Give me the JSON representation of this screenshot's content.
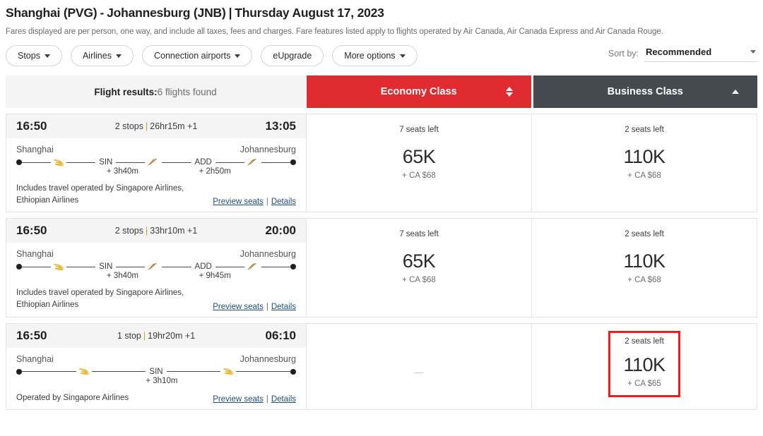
{
  "header": {
    "origin": "Shanghai (PVG)",
    "dash": "-",
    "destination": "Johannesburg (JNB)",
    "separator": "|",
    "date": "Thursday August 17, 2023",
    "fare_note": "Fares displayed are per person, one way, and include all taxes, fees and charges. Fare features listed apply to flights operated by Air Canada, Air Canada Express and Air Canada Rouge."
  },
  "filters": {
    "stops": "Stops",
    "airlines": "Airlines",
    "connection_airports": "Connection airports",
    "eupgrade": "eUpgrade",
    "more_options": "More options",
    "sort_label": "Sort by:",
    "sort_value": "Recommended"
  },
  "columns": {
    "results_label": "Flight results:",
    "results_count": "6 flights found",
    "economy": "Economy Class",
    "business": "Business Class"
  },
  "colors": {
    "economy_header": "#e02b31",
    "business_header": "#444a50",
    "highlight": "#ee1d1d",
    "link": "#1f4e79"
  },
  "flights": [
    {
      "depart_time": "16:50",
      "arrive_time": "13:05",
      "stops": "2 stops",
      "duration": "26hr15m +1",
      "next_day": "+1",
      "origin_city": "Shanghai",
      "destination_city": "Johannesburg",
      "stop_codes": [
        "SIN",
        "ADD"
      ],
      "layovers": [
        "+ 3h40m",
        "+ 2h50m"
      ],
      "operated_by": "Includes travel operated by Singapore Airlines, Ethiopian Airlines",
      "preview_seats": "Preview seats",
      "details": "Details",
      "economy": {
        "seats": "7 seats left",
        "miles": "65K",
        "tax": "+ CA $68",
        "available": true,
        "highlighted": false
      },
      "business": {
        "seats": "2 seats left",
        "miles": "110K",
        "tax": "+ CA $68",
        "available": true,
        "highlighted": false
      }
    },
    {
      "depart_time": "16:50",
      "arrive_time": "20:00",
      "stops": "2 stops",
      "duration": "33hr10m +1",
      "next_day": "+1",
      "origin_city": "Shanghai",
      "destination_city": "Johannesburg",
      "stop_codes": [
        "SIN",
        "ADD"
      ],
      "layovers": [
        "+ 3h40m",
        "+ 9h45m"
      ],
      "operated_by": "Includes travel operated by Singapore Airlines, Ethiopian Airlines",
      "preview_seats": "Preview seats",
      "details": "Details",
      "economy": {
        "seats": "7 seats left",
        "miles": "65K",
        "tax": "+ CA $68",
        "available": true,
        "highlighted": false
      },
      "business": {
        "seats": "2 seats left",
        "miles": "110K",
        "tax": "+ CA $68",
        "available": true,
        "highlighted": false
      }
    },
    {
      "depart_time": "16:50",
      "arrive_time": "06:10",
      "stops": "1 stop",
      "duration": "19hr20m +1",
      "next_day": "+1",
      "origin_city": "Shanghai",
      "destination_city": "Johannesburg",
      "stop_codes": [
        "SIN"
      ],
      "layovers": [
        "+ 3h10m"
      ],
      "operated_by": "Operated by Singapore Airlines",
      "preview_seats": "Preview seats",
      "details": "Details",
      "economy": {
        "no_fare": "—",
        "available": false,
        "highlighted": false
      },
      "business": {
        "seats": "2 seats left",
        "miles": "110K",
        "tax": "+ CA $65",
        "available": true,
        "highlighted": true
      }
    }
  ]
}
